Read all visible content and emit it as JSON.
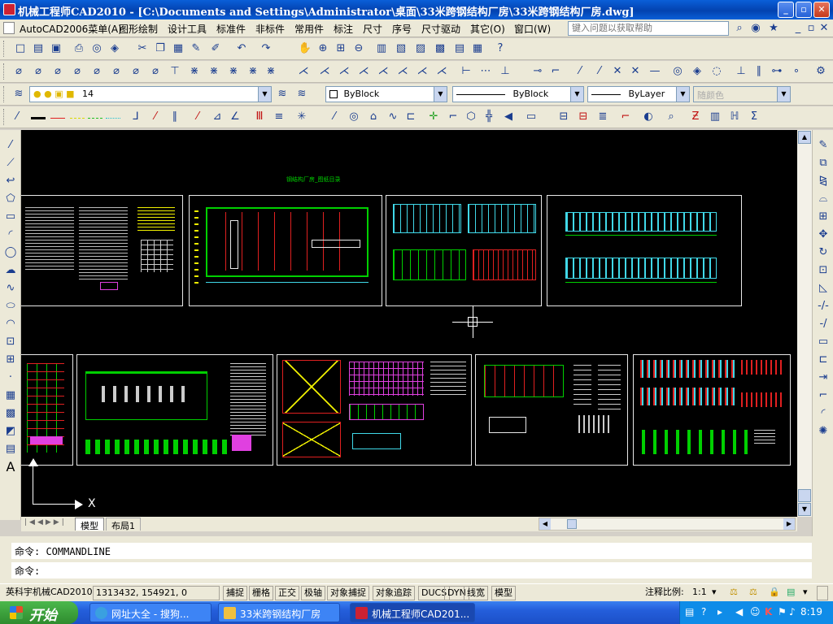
{
  "window": {
    "title": "机械工程师CAD2010 - [C:\\Documents and Settings\\Administrator\\桌面\\33米跨钢结构厂房\\33米跨钢结构厂房.dwg]",
    "min_label": "_",
    "max_label": "▫",
    "close_label": "✕"
  },
  "menubar": {
    "items": [
      "AutoCAD2006菜单(A)",
      "图形绘制",
      "设计工具",
      "标准件",
      "非标件",
      "常用件",
      "标注",
      "尺寸",
      "序号",
      "尺寸驱动",
      "其它(O)",
      "窗口(W)"
    ],
    "help_placeholder": "键入问题以获取帮助"
  },
  "layer_bar": {
    "layer_name": "14",
    "color": "ByBlock",
    "linetype": "ByBlock",
    "lineweight": "ByLayer",
    "plotstyle": "随颜色"
  },
  "canvas": {
    "heading": "钢结构厂房_图纸目录",
    "ucs_x_label": "X"
  },
  "layout_tabs": [
    "模型",
    "布局1"
  ],
  "command": {
    "history": "命令: COMMANDLINE",
    "prompt": "命令:"
  },
  "status": {
    "product": "英科宇机械CAD2010",
    "coords": "1313432, 154921, 0",
    "toggles": [
      "捕捉",
      "栅格",
      "正交",
      "极轴",
      "对象捕捉",
      "对象追踪",
      "DUCS",
      "DYN",
      "线宽",
      "模型"
    ],
    "annotation_scale_label": "注释比例:",
    "annotation_scale": "1:1"
  },
  "taskbar": {
    "start_label": "开始",
    "tasks": [
      "网址大全 - 搜狗...",
      "33米跨钢结构厂房",
      "机械工程师CAD201..."
    ],
    "clock": "8:19"
  },
  "colors": {
    "title_blue": "#0a5fd8",
    "canvas_bg": "#000000",
    "sheet_border": "#e8e8e8",
    "cad_green": "#00d000",
    "cad_red": "#e02020",
    "cad_magenta": "#e040e0",
    "cad_cyan": "#40d8e8",
    "cad_yellow": "#f0f000",
    "taskbar_blue": "#245edb"
  }
}
